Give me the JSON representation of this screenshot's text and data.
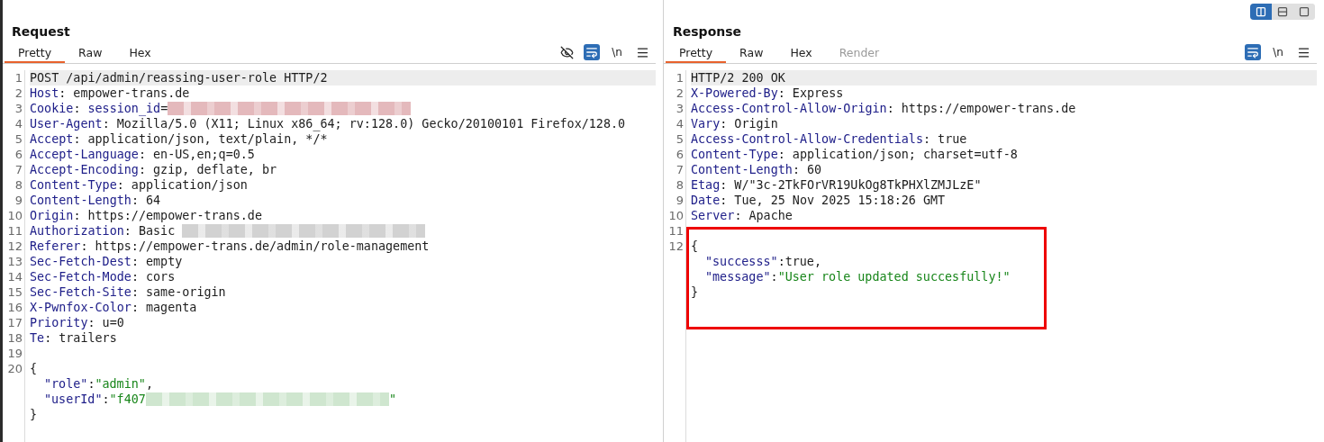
{
  "layout_toggles": [
    {
      "kind": "columns",
      "selected": true
    },
    {
      "kind": "rows",
      "selected": false
    },
    {
      "kind": "single",
      "selected": false
    }
  ],
  "panels": [
    {
      "title": "Request",
      "tabs": [
        {
          "label": "Pretty",
          "selected": true,
          "disabled": false
        },
        {
          "label": "Raw",
          "selected": false,
          "disabled": false
        },
        {
          "label": "Hex",
          "selected": false,
          "disabled": false
        }
      ],
      "tools": [
        {
          "kind": "eye-off",
          "selected": false
        },
        {
          "kind": "wrap",
          "selected": true
        },
        {
          "kind": "newline",
          "text": "\\n",
          "selected": false
        },
        {
          "kind": "menu",
          "selected": false
        }
      ],
      "rows": [
        {
          "number": "1",
          "highlighted": true,
          "boxed": false,
          "segments": [
            {
              "kind": "plain",
              "text": "POST /api/admin/reassing-user-role HTTP/2"
            }
          ]
        },
        {
          "number": "2",
          "highlighted": false,
          "boxed": false,
          "segments": [
            {
              "kind": "name",
              "text": "Host"
            },
            {
              "kind": "plain",
              "text": ": empower-trans.de"
            }
          ]
        },
        {
          "number": "3",
          "highlighted": false,
          "boxed": false,
          "segments": [
            {
              "kind": "name",
              "text": "Cookie"
            },
            {
              "kind": "plain",
              "text": ": "
            },
            {
              "kind": "name",
              "text": "session_id"
            },
            {
              "kind": "plain",
              "text": "="
            },
            {
              "kind": "redacted",
              "color": "#e4b9bc"
            }
          ]
        },
        {
          "number": "4",
          "highlighted": false,
          "boxed": false,
          "segments": [
            {
              "kind": "name",
              "text": "User-Agent"
            },
            {
              "kind": "plain",
              "text": ": Mozilla/5.0 (X11; Linux x86_64; rv:128.0) Gecko/20100101 Firefox/128.0"
            }
          ]
        },
        {
          "number": "5",
          "highlighted": false,
          "boxed": false,
          "segments": [
            {
              "kind": "name",
              "text": "Accept"
            },
            {
              "kind": "plain",
              "text": ": application/json, text/plain, */*"
            }
          ]
        },
        {
          "number": "6",
          "highlighted": false,
          "boxed": false,
          "segments": [
            {
              "kind": "name",
              "text": "Accept-Language"
            },
            {
              "kind": "plain",
              "text": ": en-US,en;q=0.5"
            }
          ]
        },
        {
          "number": "7",
          "highlighted": false,
          "boxed": false,
          "segments": [
            {
              "kind": "name",
              "text": "Accept-Encoding"
            },
            {
              "kind": "plain",
              "text": ": gzip, deflate, br"
            }
          ]
        },
        {
          "number": "8",
          "highlighted": false,
          "boxed": false,
          "segments": [
            {
              "kind": "name",
              "text": "Content-Type"
            },
            {
              "kind": "plain",
              "text": ": application/json"
            }
          ]
        },
        {
          "number": "9",
          "highlighted": false,
          "boxed": false,
          "segments": [
            {
              "kind": "name",
              "text": "Content-Length"
            },
            {
              "kind": "plain",
              "text": ": 64"
            }
          ]
        },
        {
          "number": "10",
          "highlighted": false,
          "boxed": false,
          "segments": [
            {
              "kind": "name",
              "text": "Origin"
            },
            {
              "kind": "plain",
              "text": ": https://empower-trans.de"
            }
          ]
        },
        {
          "number": "11",
          "highlighted": false,
          "boxed": false,
          "segments": [
            {
              "kind": "name",
              "text": "Authorization"
            },
            {
              "kind": "plain",
              "text": ": Basic "
            },
            {
              "kind": "redacted",
              "color": "#d2d2d2"
            }
          ]
        },
        {
          "number": "12",
          "highlighted": false,
          "boxed": false,
          "segments": [
            {
              "kind": "name",
              "text": "Referer"
            },
            {
              "kind": "plain",
              "text": ": https://empower-trans.de/admin/role-management"
            }
          ]
        },
        {
          "number": "13",
          "highlighted": false,
          "boxed": false,
          "segments": [
            {
              "kind": "name",
              "text": "Sec-Fetch-Dest"
            },
            {
              "kind": "plain",
              "text": ": empty"
            }
          ]
        },
        {
          "number": "14",
          "highlighted": false,
          "boxed": false,
          "segments": [
            {
              "kind": "name",
              "text": "Sec-Fetch-Mode"
            },
            {
              "kind": "plain",
              "text": ": cors"
            }
          ]
        },
        {
          "number": "15",
          "highlighted": false,
          "boxed": false,
          "segments": [
            {
              "kind": "name",
              "text": "Sec-Fetch-Site"
            },
            {
              "kind": "plain",
              "text": ": same-origin"
            }
          ]
        },
        {
          "number": "16",
          "highlighted": false,
          "boxed": false,
          "segments": [
            {
              "kind": "name",
              "text": "X-Pwnfox-Color"
            },
            {
              "kind": "plain",
              "text": ": magenta"
            }
          ]
        },
        {
          "number": "17",
          "highlighted": false,
          "boxed": false,
          "segments": [
            {
              "kind": "name",
              "text": "Priority"
            },
            {
              "kind": "plain",
              "text": ": u=0"
            }
          ]
        },
        {
          "number": "18",
          "highlighted": false,
          "boxed": false,
          "segments": [
            {
              "kind": "name",
              "text": "Te"
            },
            {
              "kind": "plain",
              "text": ": trailers"
            }
          ]
        },
        {
          "number": "19",
          "highlighted": false,
          "boxed": false,
          "segments": []
        },
        {
          "number": "20",
          "highlighted": false,
          "boxed": false,
          "segments": [
            {
              "kind": "plain",
              "text": "{"
            }
          ]
        },
        {
          "highlighted": false,
          "boxed": false,
          "kind": "indented",
          "segments": [
            {
              "kind": "name",
              "text": "\"role\""
            },
            {
              "kind": "plain",
              "text": ":"
            },
            {
              "kind": "string",
              "text": "\"admin\""
            },
            {
              "kind": "plain",
              "text": ","
            }
          ]
        },
        {
          "highlighted": false,
          "boxed": false,
          "kind": "indented",
          "segments": [
            {
              "kind": "name",
              "text": "\"userId\""
            },
            {
              "kind": "plain",
              "text": ":"
            },
            {
              "kind": "string",
              "text": "\"f407"
            },
            {
              "kind": "redacted",
              "color": "#cfe6cf"
            },
            {
              "kind": "string",
              "text": "\""
            }
          ]
        },
        {
          "highlighted": false,
          "boxed": false,
          "segments": [
            {
              "kind": "plain",
              "text": "}"
            }
          ]
        }
      ]
    },
    {
      "title": "Response",
      "tabs": [
        {
          "label": "Pretty",
          "selected": true,
          "disabled": false
        },
        {
          "label": "Raw",
          "selected": false,
          "disabled": false
        },
        {
          "label": "Hex",
          "selected": false,
          "disabled": false
        },
        {
          "label": "Render",
          "selected": false,
          "disabled": true
        }
      ],
      "tools": [
        {
          "kind": "wrap",
          "selected": true
        },
        {
          "kind": "newline",
          "text": "\\n",
          "selected": false
        },
        {
          "kind": "menu",
          "selected": false
        }
      ],
      "rows": [
        {
          "number": "1",
          "highlighted": true,
          "boxed": false,
          "segments": [
            {
              "kind": "plain",
              "text": "HTTP/2 200 OK"
            }
          ]
        },
        {
          "number": "2",
          "highlighted": false,
          "boxed": false,
          "segments": [
            {
              "kind": "name",
              "text": "X-Powered-By"
            },
            {
              "kind": "plain",
              "text": ": Express"
            }
          ]
        },
        {
          "number": "3",
          "highlighted": false,
          "boxed": false,
          "segments": [
            {
              "kind": "name",
              "text": "Access-Control-Allow-Origin"
            },
            {
              "kind": "plain",
              "text": ": https://empower-trans.de"
            }
          ]
        },
        {
          "number": "4",
          "highlighted": false,
          "boxed": false,
          "segments": [
            {
              "kind": "name",
              "text": "Vary"
            },
            {
              "kind": "plain",
              "text": ": Origin"
            }
          ]
        },
        {
          "number": "5",
          "highlighted": false,
          "boxed": false,
          "segments": [
            {
              "kind": "name",
              "text": "Access-Control-Allow-Credentials"
            },
            {
              "kind": "plain",
              "text": ": true"
            }
          ]
        },
        {
          "number": "6",
          "highlighted": false,
          "boxed": false,
          "segments": [
            {
              "kind": "name",
              "text": "Content-Type"
            },
            {
              "kind": "plain",
              "text": ": application/json; charset=utf-8"
            }
          ]
        },
        {
          "number": "7",
          "highlighted": false,
          "boxed": false,
          "segments": [
            {
              "kind": "name",
              "text": "Content-Length"
            },
            {
              "kind": "plain",
              "text": ": 60"
            }
          ]
        },
        {
          "number": "8",
          "highlighted": false,
          "boxed": false,
          "segments": [
            {
              "kind": "name",
              "text": "Etag"
            },
            {
              "kind": "plain",
              "text": ": W/\"3c-2TkFOrVR19UkOg8TkPHXlZMJLzE\""
            }
          ]
        },
        {
          "number": "9",
          "highlighted": false,
          "boxed": false,
          "segments": [
            {
              "kind": "name",
              "text": "Date"
            },
            {
              "kind": "plain",
              "text": ": Tue, 25 Nov 2025 15:18:26 GMT"
            }
          ]
        },
        {
          "number": "10",
          "highlighted": false,
          "boxed": false,
          "segments": [
            {
              "kind": "name",
              "text": "Server"
            },
            {
              "kind": "plain",
              "text": ": Apache"
            }
          ]
        },
        {
          "number": "11",
          "highlighted": false,
          "boxed": false,
          "segments": []
        },
        {
          "number": "12",
          "highlighted": false,
          "boxed": true,
          "segments": [
            {
              "kind": "plain",
              "text": "{"
            }
          ]
        },
        {
          "highlighted": false,
          "boxed": true,
          "kind": "indented",
          "segments": [
            {
              "kind": "name",
              "text": "\"successs\""
            },
            {
              "kind": "plain",
              "text": ":true,"
            }
          ]
        },
        {
          "highlighted": false,
          "boxed": true,
          "kind": "indented",
          "segments": [
            {
              "kind": "name",
              "text": "\"message\""
            },
            {
              "kind": "plain",
              "text": ":"
            },
            {
              "kind": "string",
              "text": "\"User role updated succesfully!\""
            }
          ]
        },
        {
          "highlighted": false,
          "boxed": true,
          "segments": [
            {
              "kind": "plain",
              "text": "}"
            }
          ]
        }
      ]
    }
  ]
}
